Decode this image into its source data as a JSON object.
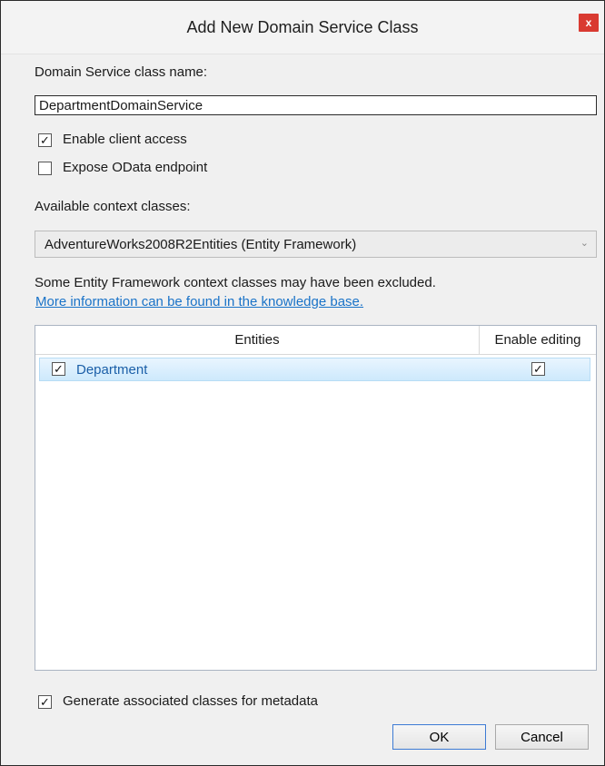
{
  "window": {
    "title": "Add New Domain Service Class",
    "close_label": "x"
  },
  "form": {
    "class_name_label": "Domain Service class name:",
    "class_name_value": "DepartmentDomainService",
    "enable_client_access_label": "Enable client access",
    "enable_client_access_checked": true,
    "expose_odata_label": "Expose OData endpoint",
    "expose_odata_checked": false,
    "context_label": "Available context classes:",
    "context_selected": "AdventureWorks2008R2Entities (Entity Framework)",
    "excluded_note": "Some Entity Framework context classes may have been excluded.",
    "kb_link": "More information can be found in the knowledge base."
  },
  "grid": {
    "headers": {
      "entities": "Entities",
      "enable_editing": "Enable editing"
    },
    "rows": [
      {
        "name": "Department",
        "selected": true,
        "enable_editing": true
      }
    ]
  },
  "footer": {
    "generate_metadata_label": "Generate associated classes for metadata",
    "generate_metadata_checked": true,
    "ok_label": "OK",
    "cancel_label": "Cancel"
  },
  "check_glyph": "✓",
  "dropdown_glyph": "⌄"
}
